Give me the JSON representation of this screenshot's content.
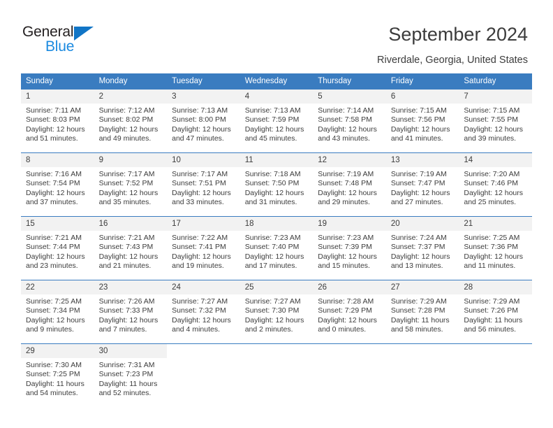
{
  "brand": {
    "name_top": "General",
    "name_bottom": "Blue"
  },
  "header": {
    "title": "September 2024",
    "subtitle": "Riverdale, Georgia, United States",
    "accent_color": "#3a7cc0",
    "daynum_bg": "#f2f2f2"
  },
  "weekdays": [
    "Sunday",
    "Monday",
    "Tuesday",
    "Wednesday",
    "Thursday",
    "Friday",
    "Saturday"
  ],
  "weeks": [
    [
      {
        "day": "1",
        "sunrise": "Sunrise: 7:11 AM",
        "sunset": "Sunset: 8:03 PM",
        "daylight_1": "Daylight: 12 hours",
        "daylight_2": "and 51 minutes."
      },
      {
        "day": "2",
        "sunrise": "Sunrise: 7:12 AM",
        "sunset": "Sunset: 8:02 PM",
        "daylight_1": "Daylight: 12 hours",
        "daylight_2": "and 49 minutes."
      },
      {
        "day": "3",
        "sunrise": "Sunrise: 7:13 AM",
        "sunset": "Sunset: 8:00 PM",
        "daylight_1": "Daylight: 12 hours",
        "daylight_2": "and 47 minutes."
      },
      {
        "day": "4",
        "sunrise": "Sunrise: 7:13 AM",
        "sunset": "Sunset: 7:59 PM",
        "daylight_1": "Daylight: 12 hours",
        "daylight_2": "and 45 minutes."
      },
      {
        "day": "5",
        "sunrise": "Sunrise: 7:14 AM",
        "sunset": "Sunset: 7:58 PM",
        "daylight_1": "Daylight: 12 hours",
        "daylight_2": "and 43 minutes."
      },
      {
        "day": "6",
        "sunrise": "Sunrise: 7:15 AM",
        "sunset": "Sunset: 7:56 PM",
        "daylight_1": "Daylight: 12 hours",
        "daylight_2": "and 41 minutes."
      },
      {
        "day": "7",
        "sunrise": "Sunrise: 7:15 AM",
        "sunset": "Sunset: 7:55 PM",
        "daylight_1": "Daylight: 12 hours",
        "daylight_2": "and 39 minutes."
      }
    ],
    [
      {
        "day": "8",
        "sunrise": "Sunrise: 7:16 AM",
        "sunset": "Sunset: 7:54 PM",
        "daylight_1": "Daylight: 12 hours",
        "daylight_2": "and 37 minutes."
      },
      {
        "day": "9",
        "sunrise": "Sunrise: 7:17 AM",
        "sunset": "Sunset: 7:52 PM",
        "daylight_1": "Daylight: 12 hours",
        "daylight_2": "and 35 minutes."
      },
      {
        "day": "10",
        "sunrise": "Sunrise: 7:17 AM",
        "sunset": "Sunset: 7:51 PM",
        "daylight_1": "Daylight: 12 hours",
        "daylight_2": "and 33 minutes."
      },
      {
        "day": "11",
        "sunrise": "Sunrise: 7:18 AM",
        "sunset": "Sunset: 7:50 PM",
        "daylight_1": "Daylight: 12 hours",
        "daylight_2": "and 31 minutes."
      },
      {
        "day": "12",
        "sunrise": "Sunrise: 7:19 AM",
        "sunset": "Sunset: 7:48 PM",
        "daylight_1": "Daylight: 12 hours",
        "daylight_2": "and 29 minutes."
      },
      {
        "day": "13",
        "sunrise": "Sunrise: 7:19 AM",
        "sunset": "Sunset: 7:47 PM",
        "daylight_1": "Daylight: 12 hours",
        "daylight_2": "and 27 minutes."
      },
      {
        "day": "14",
        "sunrise": "Sunrise: 7:20 AM",
        "sunset": "Sunset: 7:46 PM",
        "daylight_1": "Daylight: 12 hours",
        "daylight_2": "and 25 minutes."
      }
    ],
    [
      {
        "day": "15",
        "sunrise": "Sunrise: 7:21 AM",
        "sunset": "Sunset: 7:44 PM",
        "daylight_1": "Daylight: 12 hours",
        "daylight_2": "and 23 minutes."
      },
      {
        "day": "16",
        "sunrise": "Sunrise: 7:21 AM",
        "sunset": "Sunset: 7:43 PM",
        "daylight_1": "Daylight: 12 hours",
        "daylight_2": "and 21 minutes."
      },
      {
        "day": "17",
        "sunrise": "Sunrise: 7:22 AM",
        "sunset": "Sunset: 7:41 PM",
        "daylight_1": "Daylight: 12 hours",
        "daylight_2": "and 19 minutes."
      },
      {
        "day": "18",
        "sunrise": "Sunrise: 7:23 AM",
        "sunset": "Sunset: 7:40 PM",
        "daylight_1": "Daylight: 12 hours",
        "daylight_2": "and 17 minutes."
      },
      {
        "day": "19",
        "sunrise": "Sunrise: 7:23 AM",
        "sunset": "Sunset: 7:39 PM",
        "daylight_1": "Daylight: 12 hours",
        "daylight_2": "and 15 minutes."
      },
      {
        "day": "20",
        "sunrise": "Sunrise: 7:24 AM",
        "sunset": "Sunset: 7:37 PM",
        "daylight_1": "Daylight: 12 hours",
        "daylight_2": "and 13 minutes."
      },
      {
        "day": "21",
        "sunrise": "Sunrise: 7:25 AM",
        "sunset": "Sunset: 7:36 PM",
        "daylight_1": "Daylight: 12 hours",
        "daylight_2": "and 11 minutes."
      }
    ],
    [
      {
        "day": "22",
        "sunrise": "Sunrise: 7:25 AM",
        "sunset": "Sunset: 7:34 PM",
        "daylight_1": "Daylight: 12 hours",
        "daylight_2": "and 9 minutes."
      },
      {
        "day": "23",
        "sunrise": "Sunrise: 7:26 AM",
        "sunset": "Sunset: 7:33 PM",
        "daylight_1": "Daylight: 12 hours",
        "daylight_2": "and 7 minutes."
      },
      {
        "day": "24",
        "sunrise": "Sunrise: 7:27 AM",
        "sunset": "Sunset: 7:32 PM",
        "daylight_1": "Daylight: 12 hours",
        "daylight_2": "and 4 minutes."
      },
      {
        "day": "25",
        "sunrise": "Sunrise: 7:27 AM",
        "sunset": "Sunset: 7:30 PM",
        "daylight_1": "Daylight: 12 hours",
        "daylight_2": "and 2 minutes."
      },
      {
        "day": "26",
        "sunrise": "Sunrise: 7:28 AM",
        "sunset": "Sunset: 7:29 PM",
        "daylight_1": "Daylight: 12 hours",
        "daylight_2": "and 0 minutes."
      },
      {
        "day": "27",
        "sunrise": "Sunrise: 7:29 AM",
        "sunset": "Sunset: 7:28 PM",
        "daylight_1": "Daylight: 11 hours",
        "daylight_2": "and 58 minutes."
      },
      {
        "day": "28",
        "sunrise": "Sunrise: 7:29 AM",
        "sunset": "Sunset: 7:26 PM",
        "daylight_1": "Daylight: 11 hours",
        "daylight_2": "and 56 minutes."
      }
    ],
    [
      {
        "day": "29",
        "sunrise": "Sunrise: 7:30 AM",
        "sunset": "Sunset: 7:25 PM",
        "daylight_1": "Daylight: 11 hours",
        "daylight_2": "and 54 minutes."
      },
      {
        "day": "30",
        "sunrise": "Sunrise: 7:31 AM",
        "sunset": "Sunset: 7:23 PM",
        "daylight_1": "Daylight: 11 hours",
        "daylight_2": "and 52 minutes."
      },
      {
        "day": "",
        "sunrise": "",
        "sunset": "",
        "daylight_1": "",
        "daylight_2": ""
      },
      {
        "day": "",
        "sunrise": "",
        "sunset": "",
        "daylight_1": "",
        "daylight_2": ""
      },
      {
        "day": "",
        "sunrise": "",
        "sunset": "",
        "daylight_1": "",
        "daylight_2": ""
      },
      {
        "day": "",
        "sunrise": "",
        "sunset": "",
        "daylight_1": "",
        "daylight_2": ""
      },
      {
        "day": "",
        "sunrise": "",
        "sunset": "",
        "daylight_1": "",
        "daylight_2": ""
      }
    ]
  ]
}
